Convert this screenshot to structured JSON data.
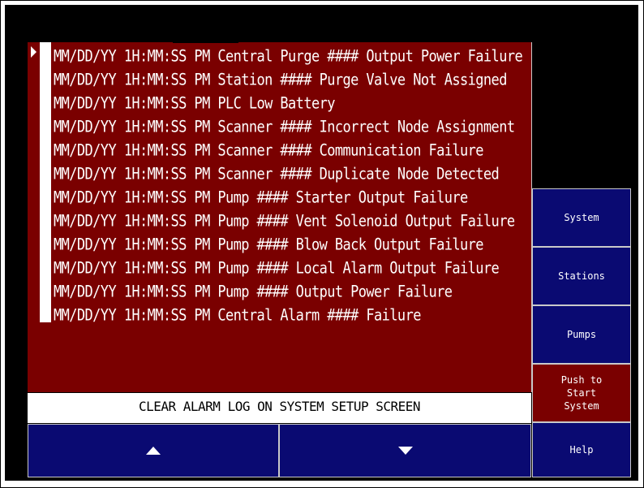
{
  "alarm_log": {
    "entries": [
      "MM/DD/YY 1H:MM:SS PM Central Purge #### Output Power Failure",
      "MM/DD/YY 1H:MM:SS PM Station #### Purge Valve Not Assigned",
      "MM/DD/YY 1H:MM:SS PM PLC Low Battery",
      "MM/DD/YY 1H:MM:SS PM Scanner #### Incorrect Node Assignment",
      "MM/DD/YY 1H:MM:SS PM Scanner #### Communication Failure",
      "MM/DD/YY 1H:MM:SS PM Scanner #### Duplicate Node Detected",
      "MM/DD/YY 1H:MM:SS PM Pump #### Starter Output Failure",
      "MM/DD/YY 1H:MM:SS PM Pump #### Vent Solenoid Output Failure",
      "MM/DD/YY 1H:MM:SS PM Pump #### Blow Back Output Failure",
      "MM/DD/YY 1H:MM:SS PM Pump #### Local Alarm Output Failure",
      "MM/DD/YY 1H:MM:SS PM Pump #### Output Power Failure",
      "MM/DD/YY 1H:MM:SS PM Central Alarm #### Failure"
    ]
  },
  "status_message": "CLEAR ALARM LOG ON SYSTEM SETUP SCREEN",
  "side_menu": {
    "system": "System",
    "stations": "Stations",
    "pumps": "Pumps",
    "start_system": "Push to\nStart\nSystem",
    "help": "Help"
  },
  "icons": {
    "scroll_up": "triangle-up-icon",
    "scroll_down": "triangle-down-icon",
    "cursor": "triangle-right-icon"
  },
  "colors": {
    "alarm_background": "#7a0000",
    "button_background": "#0a0a72",
    "screen_background": "#000000"
  }
}
